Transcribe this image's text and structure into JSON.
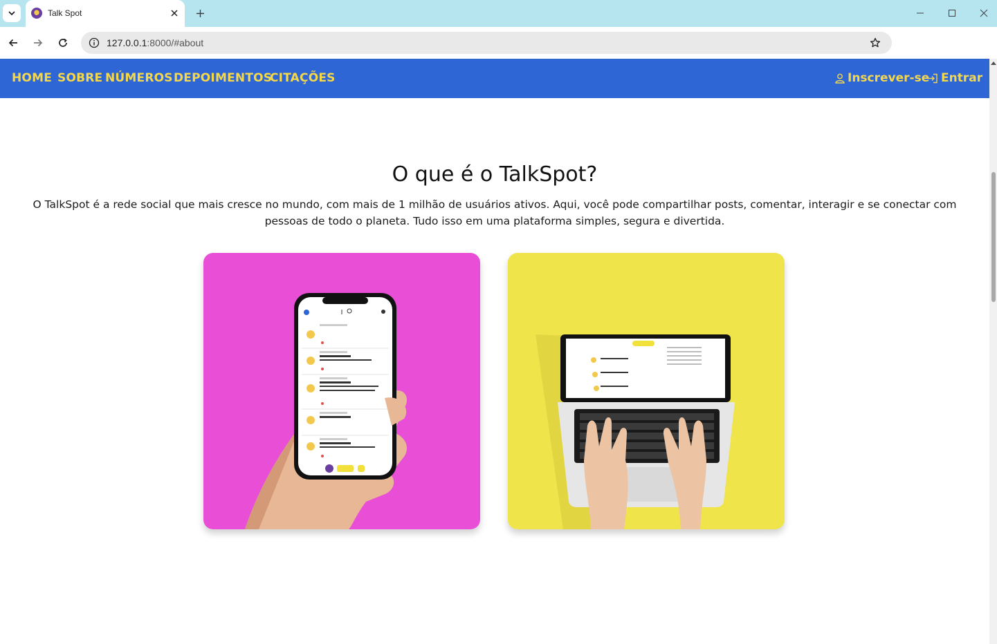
{
  "browser": {
    "tab_title": "Talk Spot",
    "url_host": "127.0.0.1",
    "url_path": ":8000/#about"
  },
  "navbar": {
    "links": [
      "HOME",
      "SOBRE",
      "NÚMEROS",
      "DEPOIMENTOS",
      "CITAÇÕES"
    ],
    "signup_label": "Inscrever-se",
    "login_label": "Entrar"
  },
  "about": {
    "title": "O que é o TalkSpot?",
    "description": "O TalkSpot é a rede social que mais cresce no mundo, com mais de 1 milhão de usuários ativos. Aqui, você pode compartilhar posts, comentar, interagir e se conectar com pessoas de todo o planeta. Tudo isso em uma plataforma simples, segura e divertida."
  },
  "images": {
    "phone_card": "hand-holding-phone-image",
    "laptop_card": "hands-on-laptop-image"
  },
  "colors": {
    "navbar": "#2f66d6",
    "nav_text": "#f5d84a",
    "pink_card": "#e94fd6",
    "yellow_card": "#f0e44b",
    "tabbar": "#b6e5f0"
  }
}
